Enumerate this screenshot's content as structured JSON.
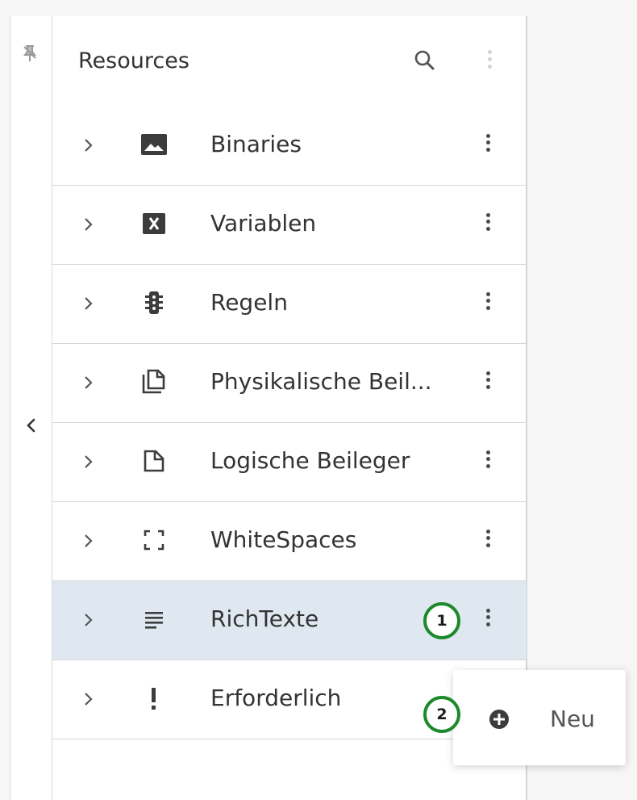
{
  "panel": {
    "title": "Resources",
    "items": [
      {
        "label": "Binaries",
        "icon": "image-icon"
      },
      {
        "label": "Variablen",
        "icon": "variable-icon"
      },
      {
        "label": "Regeln",
        "icon": "rules-icon"
      },
      {
        "label": "Physikalische Beil...",
        "icon": "copy-document-icon"
      },
      {
        "label": "Logische Beileger",
        "icon": "document-icon"
      },
      {
        "label": "WhiteSpaces",
        "icon": "whitespace-icon"
      },
      {
        "label": "RichTexte",
        "icon": "text-lines-icon",
        "selected": true
      },
      {
        "label": "Erforderlich",
        "icon": "exclamation-icon"
      }
    ]
  },
  "context_menu": {
    "items": [
      {
        "label": "Neu",
        "icon": "plus-circle-icon"
      }
    ]
  },
  "callouts": [
    "1",
    "2"
  ],
  "colors": {
    "selected_row": "#dfe8f1",
    "callout_border": "#1c8a2a",
    "icon": "#3c3c3c"
  }
}
